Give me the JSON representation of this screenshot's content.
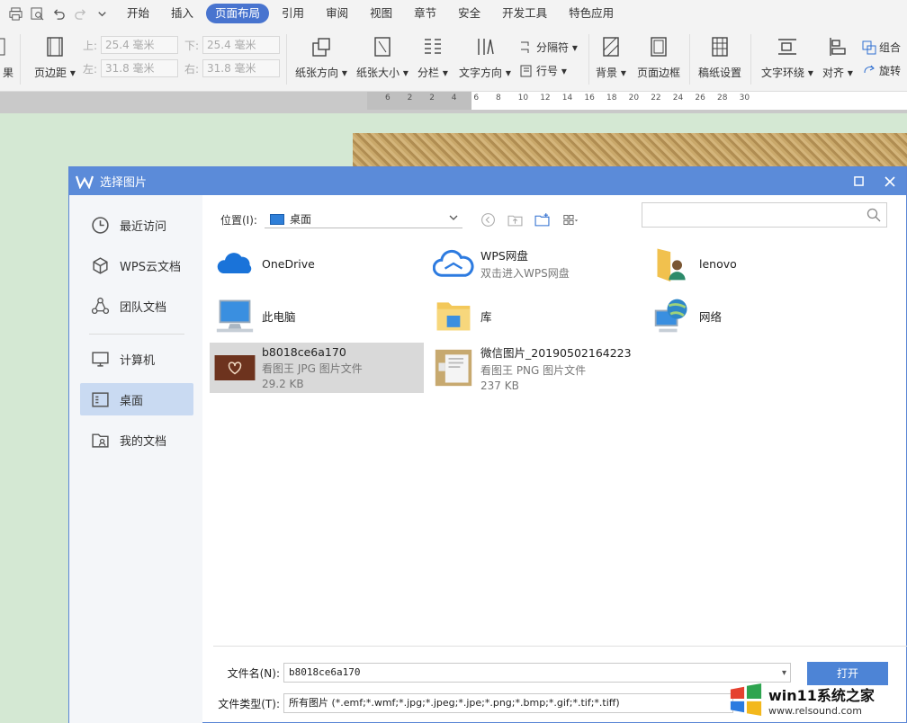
{
  "menu": {
    "tabs": [
      "开始",
      "插入",
      "页面布局",
      "引用",
      "审阅",
      "视图",
      "章节",
      "安全",
      "开发工具",
      "特色应用"
    ],
    "active_tab": "页面布局"
  },
  "ribbon": {
    "left_cut": "果",
    "margin_button": "页边距",
    "margins": {
      "top_label": "上:",
      "top_value": "25.4 毫米",
      "bottom_label": "下:",
      "bottom_value": "25.4 毫米",
      "left_label": "左:",
      "left_value": "31.8 毫米",
      "right_label": "右:",
      "right_value": "31.8 毫米"
    },
    "orientation": "纸张方向",
    "size": "纸张大小",
    "columns": "分栏",
    "text_direction": "文字方向",
    "separator": "分隔符",
    "line_number": "行号",
    "background": "背景",
    "page_border": "页面边框",
    "manuscript": "稿纸设置",
    "wrap": "文字环绕",
    "align": "对齐",
    "group": "组合",
    "rotate": "旋转"
  },
  "ruler": {
    "ticks": [
      "6",
      "2",
      "2",
      "4",
      "6",
      "8",
      "10",
      "12",
      "14",
      "16",
      "18",
      "20",
      "22",
      "24",
      "26",
      "28",
      "30"
    ]
  },
  "dialog": {
    "title": "选择图片",
    "sidebar": [
      {
        "label": "最近访问",
        "icon": "clock-icon"
      },
      {
        "label": "WPS云文档",
        "icon": "cube-icon"
      },
      {
        "label": "团队文档",
        "icon": "team-icon"
      },
      {
        "label": "计算机",
        "icon": "monitor-icon"
      },
      {
        "label": "桌面",
        "icon": "desktop-icon"
      },
      {
        "label": "我的文档",
        "icon": "documents-icon"
      }
    ],
    "active_sidebar": "桌面",
    "location_label": "位置(I):",
    "location_value": "桌面",
    "search_placeholder": "",
    "items": [
      {
        "name": "OneDrive",
        "sub": "",
        "size": "",
        "icon": "onedrive-icon"
      },
      {
        "name": "WPS网盘",
        "sub": "双击进入WPS网盘",
        "size": "",
        "icon": "wps-cloud-icon"
      },
      {
        "name": "lenovo",
        "sub": "",
        "size": "",
        "icon": "user-folder-icon"
      },
      {
        "name": "此电脑",
        "sub": "",
        "size": "",
        "icon": "computer-icon"
      },
      {
        "name": "库",
        "sub": "",
        "size": "",
        "icon": "library-icon"
      },
      {
        "name": "网络",
        "sub": "",
        "size": "",
        "icon": "network-icon"
      },
      {
        "name": "b8018ce6a170",
        "sub": "看图王 JPG 图片文件",
        "size": "29.2 KB",
        "icon": "jpg-thumbnail-icon"
      },
      {
        "name": "微信图片_20190502164223",
        "sub": "看图王 PNG 图片文件",
        "size": "237 KB",
        "icon": "png-thumbnail-icon"
      }
    ],
    "filename_label": "文件名(N):",
    "filename_value": "b8018ce6a170",
    "filetype_label": "文件类型(T):",
    "filetype_value": "所有图片 (*.emf;*.wmf;*.jpg;*.jpeg;*.jpe;*.png;*.bmp;*.gif;*.tif;*.tiff)",
    "open_button": "打开"
  },
  "watermark": {
    "line1": "win11系统之家",
    "line2": "www.relsound.com"
  },
  "colors": {
    "accent": "#4874cf",
    "titlebar": "#5b8bd9",
    "selected_sidebar": "#c9daf2",
    "selected_item": "#d9d9d9",
    "doc_background": "#d4e8d3"
  }
}
